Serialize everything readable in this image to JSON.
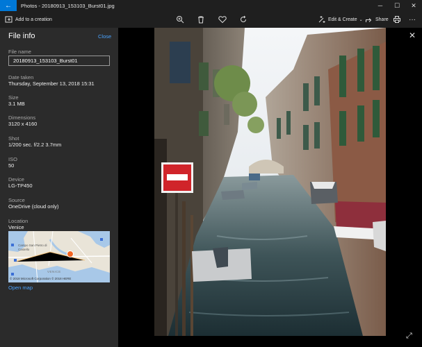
{
  "window": {
    "title": "Photos - 20180913_153103_Burst01.jpg"
  },
  "toolbar": {
    "add_to_creation": "Add to a creation",
    "edit_create": "Edit & Create",
    "share": "Share"
  },
  "file_info": {
    "title": "File info",
    "close": "Close",
    "file_name_label": "File name",
    "file_name_value": "20180913_153103_Burst01",
    "date_taken_label": "Date taken",
    "date_taken_value": "Thursday, September 13, 2018 15:31",
    "size_label": "Size",
    "size_value": "3.1 MB",
    "dimensions_label": "Dimensions",
    "dimensions_value": "3120 x 4160",
    "shot_label": "Shot",
    "shot_value": "1/200 sec. f/2.2 3.7mm",
    "iso_label": "ISO",
    "iso_value": "50",
    "device_label": "Device",
    "device_value": "LG-TP450",
    "source_label": "Source",
    "source_value": "OneDrive (cloud only)",
    "location_label": "Location",
    "location_value": "Venice",
    "map_copyright": "© 2018 Microsoft Corporation © 2018 HERE",
    "map_labels": [
      "Campo San Pietro di Castello",
      "VENICE"
    ],
    "open_map": "Open map"
  },
  "colors": {
    "accent": "#0078d7",
    "link": "#4aa3ff",
    "panel_bg": "#2b2b2b",
    "map_pin": "#f26522"
  }
}
